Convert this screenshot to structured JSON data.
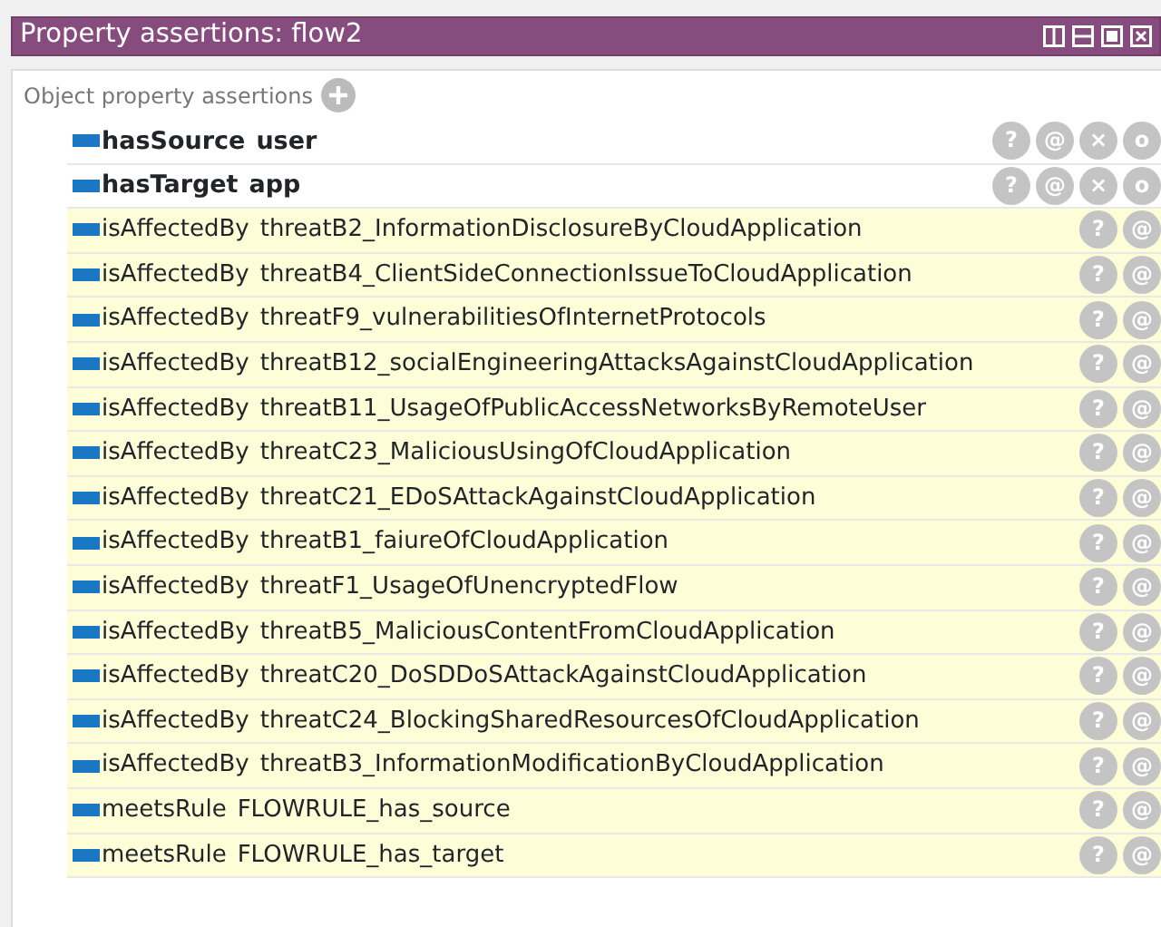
{
  "window": {
    "title": "Property assertions: flow2"
  },
  "section": {
    "title": "Object property assertions"
  },
  "assertions": [
    {
      "kind": "asserted",
      "property": "hasSource",
      "value": "user",
      "buttons": [
        "?",
        "@",
        "×",
        "o"
      ]
    },
    {
      "kind": "asserted",
      "property": "hasTarget",
      "value": "app",
      "buttons": [
        "?",
        "@",
        "×",
        "o"
      ]
    },
    {
      "kind": "inferred",
      "property": "isAffectedBy",
      "value": "threatB2_InformationDisclosureByCloudApplication",
      "buttons": [
        "?",
        "@"
      ]
    },
    {
      "kind": "inferred",
      "property": "isAffectedBy",
      "value": "threatB4_ClientSideConnectionIssueToCloudApplication",
      "buttons": [
        "?",
        "@"
      ]
    },
    {
      "kind": "inferred",
      "property": "isAffectedBy",
      "value": "threatF9_vulnerabilitiesOfInternetProtocols",
      "buttons": [
        "?",
        "@"
      ]
    },
    {
      "kind": "inferred",
      "property": "isAffectedBy",
      "value": "threatB12_socialEngineeringAttacksAgainstCloudApplication",
      "buttons": [
        "?",
        "@"
      ]
    },
    {
      "kind": "inferred",
      "property": "isAffectedBy",
      "value": "threatB11_UsageOfPublicAccessNetworksByRemoteUser",
      "buttons": [
        "?",
        "@"
      ]
    },
    {
      "kind": "inferred",
      "property": "isAffectedBy",
      "value": "threatC23_MaliciousUsingOfCloudApplication",
      "buttons": [
        "?",
        "@"
      ]
    },
    {
      "kind": "inferred",
      "property": "isAffectedBy",
      "value": "threatC21_EDoSAttackAgainstCloudApplication",
      "buttons": [
        "?",
        "@"
      ]
    },
    {
      "kind": "inferred",
      "property": "isAffectedBy",
      "value": "threatB1_faiureOfCloudApplication",
      "buttons": [
        "?",
        "@"
      ]
    },
    {
      "kind": "inferred",
      "property": "isAffectedBy",
      "value": "threatF1_UsageOfUnencryptedFlow",
      "buttons": [
        "?",
        "@"
      ]
    },
    {
      "kind": "inferred",
      "property": "isAffectedBy",
      "value": "threatB5_MaliciousContentFromCloudApplication",
      "buttons": [
        "?",
        "@"
      ]
    },
    {
      "kind": "inferred",
      "property": "isAffectedBy",
      "value": "threatC20_DoSDDoSAttackAgainstCloudApplication",
      "buttons": [
        "?",
        "@"
      ]
    },
    {
      "kind": "inferred",
      "property": "isAffectedBy",
      "value": "threatC24_BlockingSharedResourcesOfCloudApplication",
      "buttons": [
        "?",
        "@"
      ]
    },
    {
      "kind": "inferred",
      "property": "isAffectedBy",
      "value": "threatB3_InformationModificationByCloudApplication",
      "buttons": [
        "?",
        "@"
      ]
    },
    {
      "kind": "inferred",
      "property": "meetsRule",
      "value": "FLOWRULE_has_source",
      "buttons": [
        "?",
        "@"
      ]
    },
    {
      "kind": "inferred",
      "property": "meetsRule",
      "value": "FLOWRULE_has_target",
      "buttons": [
        "?",
        "@"
      ]
    }
  ]
}
